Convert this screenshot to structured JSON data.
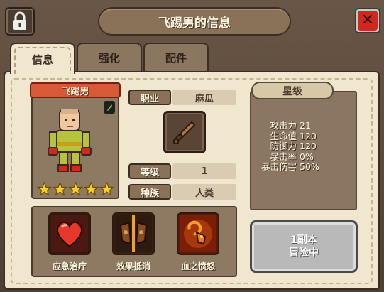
{
  "window": {
    "title": "飞踢男的信息"
  },
  "tabs": [
    {
      "label": "信息",
      "active": true
    },
    {
      "label": "强化",
      "active": false
    },
    {
      "label": "配件",
      "active": false
    }
  ],
  "character": {
    "name": "飞踢男",
    "stars": 5,
    "job_label": "职业",
    "job_value": "麻瓜",
    "level_label": "等级",
    "level_value": "1",
    "race_label": "种族",
    "race_value": "人类"
  },
  "star_level": {
    "title": "星级",
    "stats": [
      {
        "name": "攻击力",
        "value": "21"
      },
      {
        "name": "生命值",
        "value": "120"
      },
      {
        "name": "防御力",
        "value": "120"
      },
      {
        "name": "暴击率",
        "value": "0%"
      },
      {
        "name": "暴击伤害",
        "value": "50%"
      }
    ]
  },
  "skills": [
    {
      "label": "应急治疗",
      "icon": "heart-icon"
    },
    {
      "label": "效果抵消",
      "icon": "shield-icon"
    },
    {
      "label": "血之愤怒",
      "icon": "ram-icon"
    }
  ],
  "dungeon": {
    "line1": "1副本",
    "line2": "冒险中"
  },
  "colors": {
    "accent": "#d65a35",
    "close": "#d1271e",
    "panel": "#f1e7cf"
  }
}
